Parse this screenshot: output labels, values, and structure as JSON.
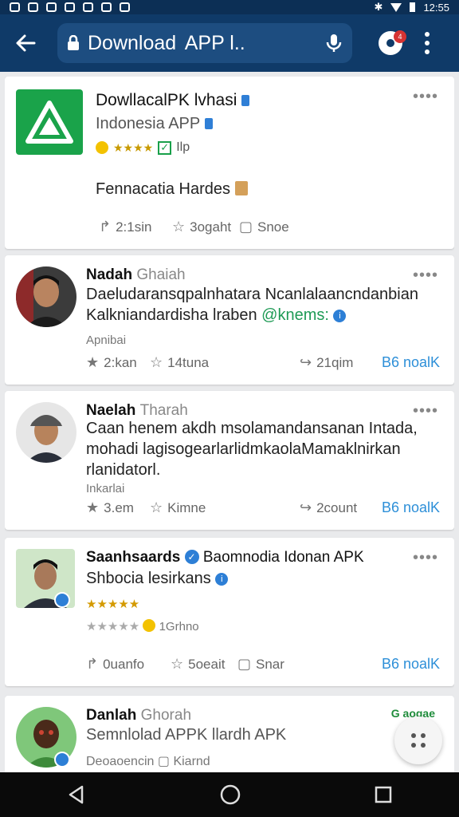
{
  "status_bar": {
    "time": "12:55"
  },
  "app_bar": {
    "url_title": "Download  APP l..",
    "notification_count": "4"
  },
  "posts": [
    {
      "title": "DowllacalPK lvhasi",
      "subtitle": "Indonesia APP",
      "stars": "★★★★",
      "badge": "Ilp",
      "description": "Fennacatia Hardes",
      "actions": {
        "share_count": "2:1sin",
        "favorite": "3ogaht",
        "save": "Snoe"
      }
    },
    {
      "name": "Nadah",
      "handle": "Ghaiah",
      "line1": "Daeludaransqpalnhatara Ncanlalaancndanbian",
      "line2": "Kalkniandardisha lraben",
      "mention": "@knems:",
      "meta": "Apnibai",
      "actions": {
        "like": "2:kan",
        "favorite": "14tuna",
        "share": "21qim",
        "cta": "B6 noalK"
      }
    },
    {
      "name": "Naelah",
      "handle": "Tharah",
      "line1": "Caan henem akdh msolamandansanan Intada,",
      "line2": "mohadi lagisogearlarlidmkaolaMamaklnirkan",
      "line3": "rlanidatorl.",
      "meta": "Inkarlai",
      "actions": {
        "like": "3.em",
        "favorite": "Kimne",
        "share": "2count",
        "cta": "B6 noalK"
      }
    },
    {
      "name": "Saanhsaards",
      "rest": "Baomnodia Idonan APK",
      "line2": "Shbocia lesirkans",
      "stars": "★★★★★",
      "rating_row": "★★★★★",
      "rating_text": "1Grhno",
      "actions": {
        "share_count": "0uanfo",
        "favorite": "5oeait",
        "save": "Snar",
        "cta": "B6 noalK"
      }
    },
    {
      "name": "Danlah",
      "handle": "Ghorah",
      "line1": "Semnlolad APPK llardh APK",
      "meta1": "Deoaoencin",
      "meta2": "Kiarnd",
      "tag": "G aogae"
    }
  ]
}
